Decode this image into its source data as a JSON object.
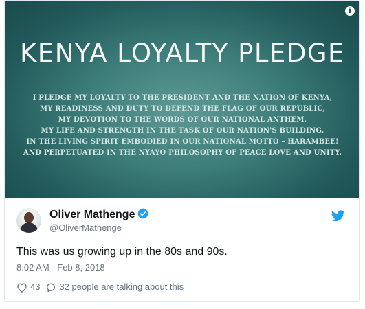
{
  "media": {
    "title": "KENYA LOYALTY PLEDGE",
    "lines": [
      "I PLEDGE MY LOYALTY TO THE PRESIDENT AND THE NATION OF KENYA,",
      "MY READINESS AND DUTY TO DEFEND THE FLAG OF OUR REPUBLIC,",
      "MY DEVOTION TO THE WORDS OF OUR NATIONAL ANTHEM,",
      "MY LIFE AND STRENGTH IN THE TASK OF OUR NATION'S BUILDING.",
      "IN THE LIVING SPIRIT EMBODIED IN OUR NATIONAL MOTTO – HARAMBEE!",
      "AND PERPETUATED IN THE NYAYO PHILOSOPHY OF PEACE LOVE AND UNITY."
    ],
    "info_icon": "info-icon",
    "bg_color": "#2f6c6b",
    "text_color": "#f4f7f6"
  },
  "author": {
    "name": "Oliver Mathenge",
    "handle": "@OliverMathenge",
    "verified_icon": "verified-badge-icon"
  },
  "tweet": {
    "text": "This was us growing up in the 80s and 90s.",
    "timestamp": "8:02 AM - Feb 8, 2018"
  },
  "actions": {
    "likes": "43",
    "talking": "32 people are talking about this"
  },
  "colors": {
    "accent": "#1da1f2",
    "muted": "#657786",
    "text": "#14171a"
  }
}
